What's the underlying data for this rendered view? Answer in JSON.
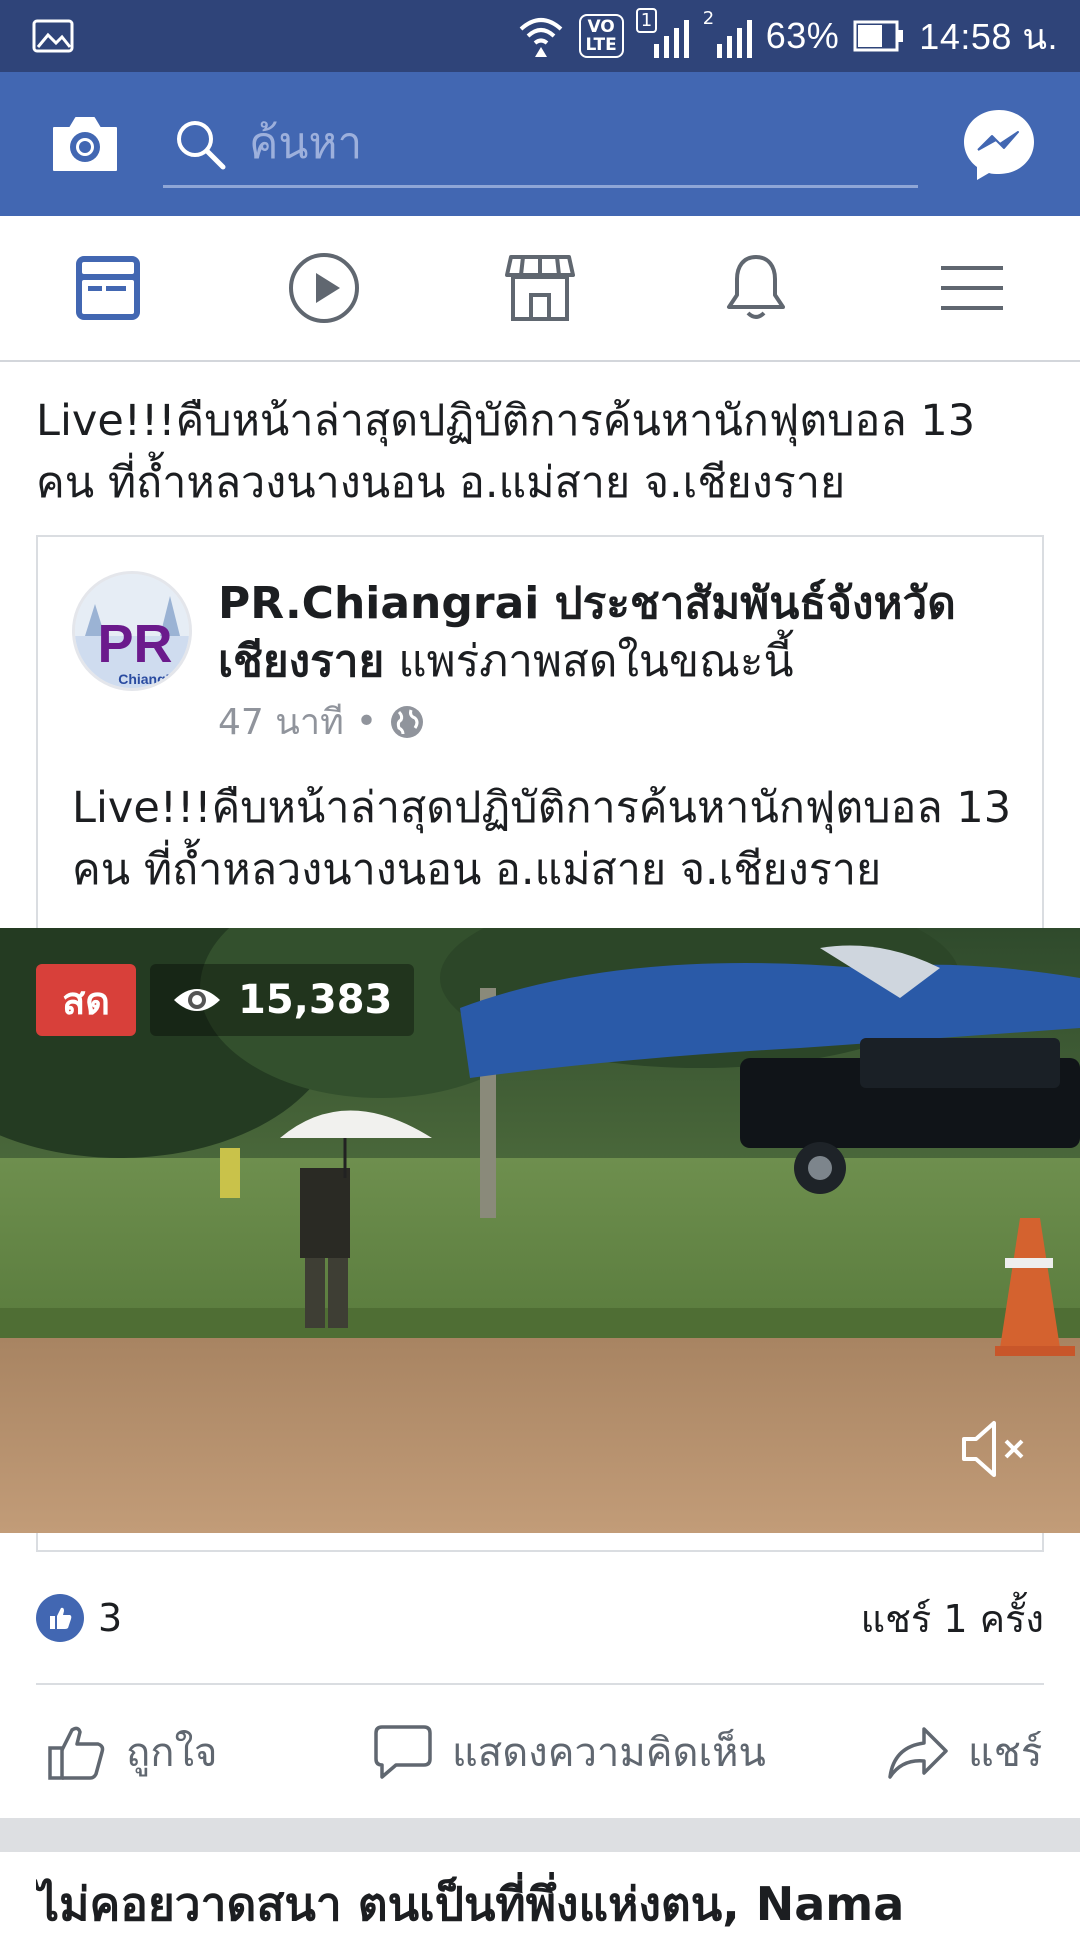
{
  "status_bar": {
    "battery": "63%",
    "time": "14:58 น.",
    "sim1": "1",
    "sim2": "2",
    "volte": "VoLTE"
  },
  "header": {
    "search_placeholder": "ค้นหา",
    "accent": "#4267b2"
  },
  "nav_tabs": [
    {
      "name": "news-feed",
      "icon": "news-feed-icon",
      "active": true
    },
    {
      "name": "watch",
      "icon": "play-icon"
    },
    {
      "name": "marketplace",
      "icon": "store-icon"
    },
    {
      "name": "notifications",
      "icon": "bell-icon"
    },
    {
      "name": "menu",
      "icon": "hamburger-icon"
    }
  ],
  "post": {
    "caption": "Live!!!คืบหน้าล่าสุดปฏิบัติการค้นหานักฟุตบอล 13 คน ที่ถ้ำหลวงนางนอน อ.แม่สาย จ.เชียงราย",
    "shared": {
      "avatar_text": "PR",
      "avatar_subtext": "ChiangR",
      "author": "PR.Chiangrai ประชาสัมพันธ์จังหวัดเชียงราย",
      "action": "แพร่ภาพสดในขณะนี้",
      "time": "47 นาที",
      "separator": "•",
      "text": "Live!!!คืบหน้าล่าสุดปฏิบัติการค้นหานักฟุตบอล 13 คน ที่ถ้ำหลวงนางนอน อ.แม่สาย จ.เชียงราย",
      "video": {
        "live_label": "สด",
        "views": "15,383",
        "live_color": "#d8403a"
      }
    },
    "likes": "3",
    "shares": "แชร์ 1 ครั้ง",
    "actions": {
      "like": "ถูกใจ",
      "comment": "แสดงความคิดเห็น",
      "share": "แชร์"
    }
  },
  "next_post": {
    "title": "ไม่คอยวาดสนา ตนเป็นที่พึ่งแห่งตน, Nama"
  }
}
